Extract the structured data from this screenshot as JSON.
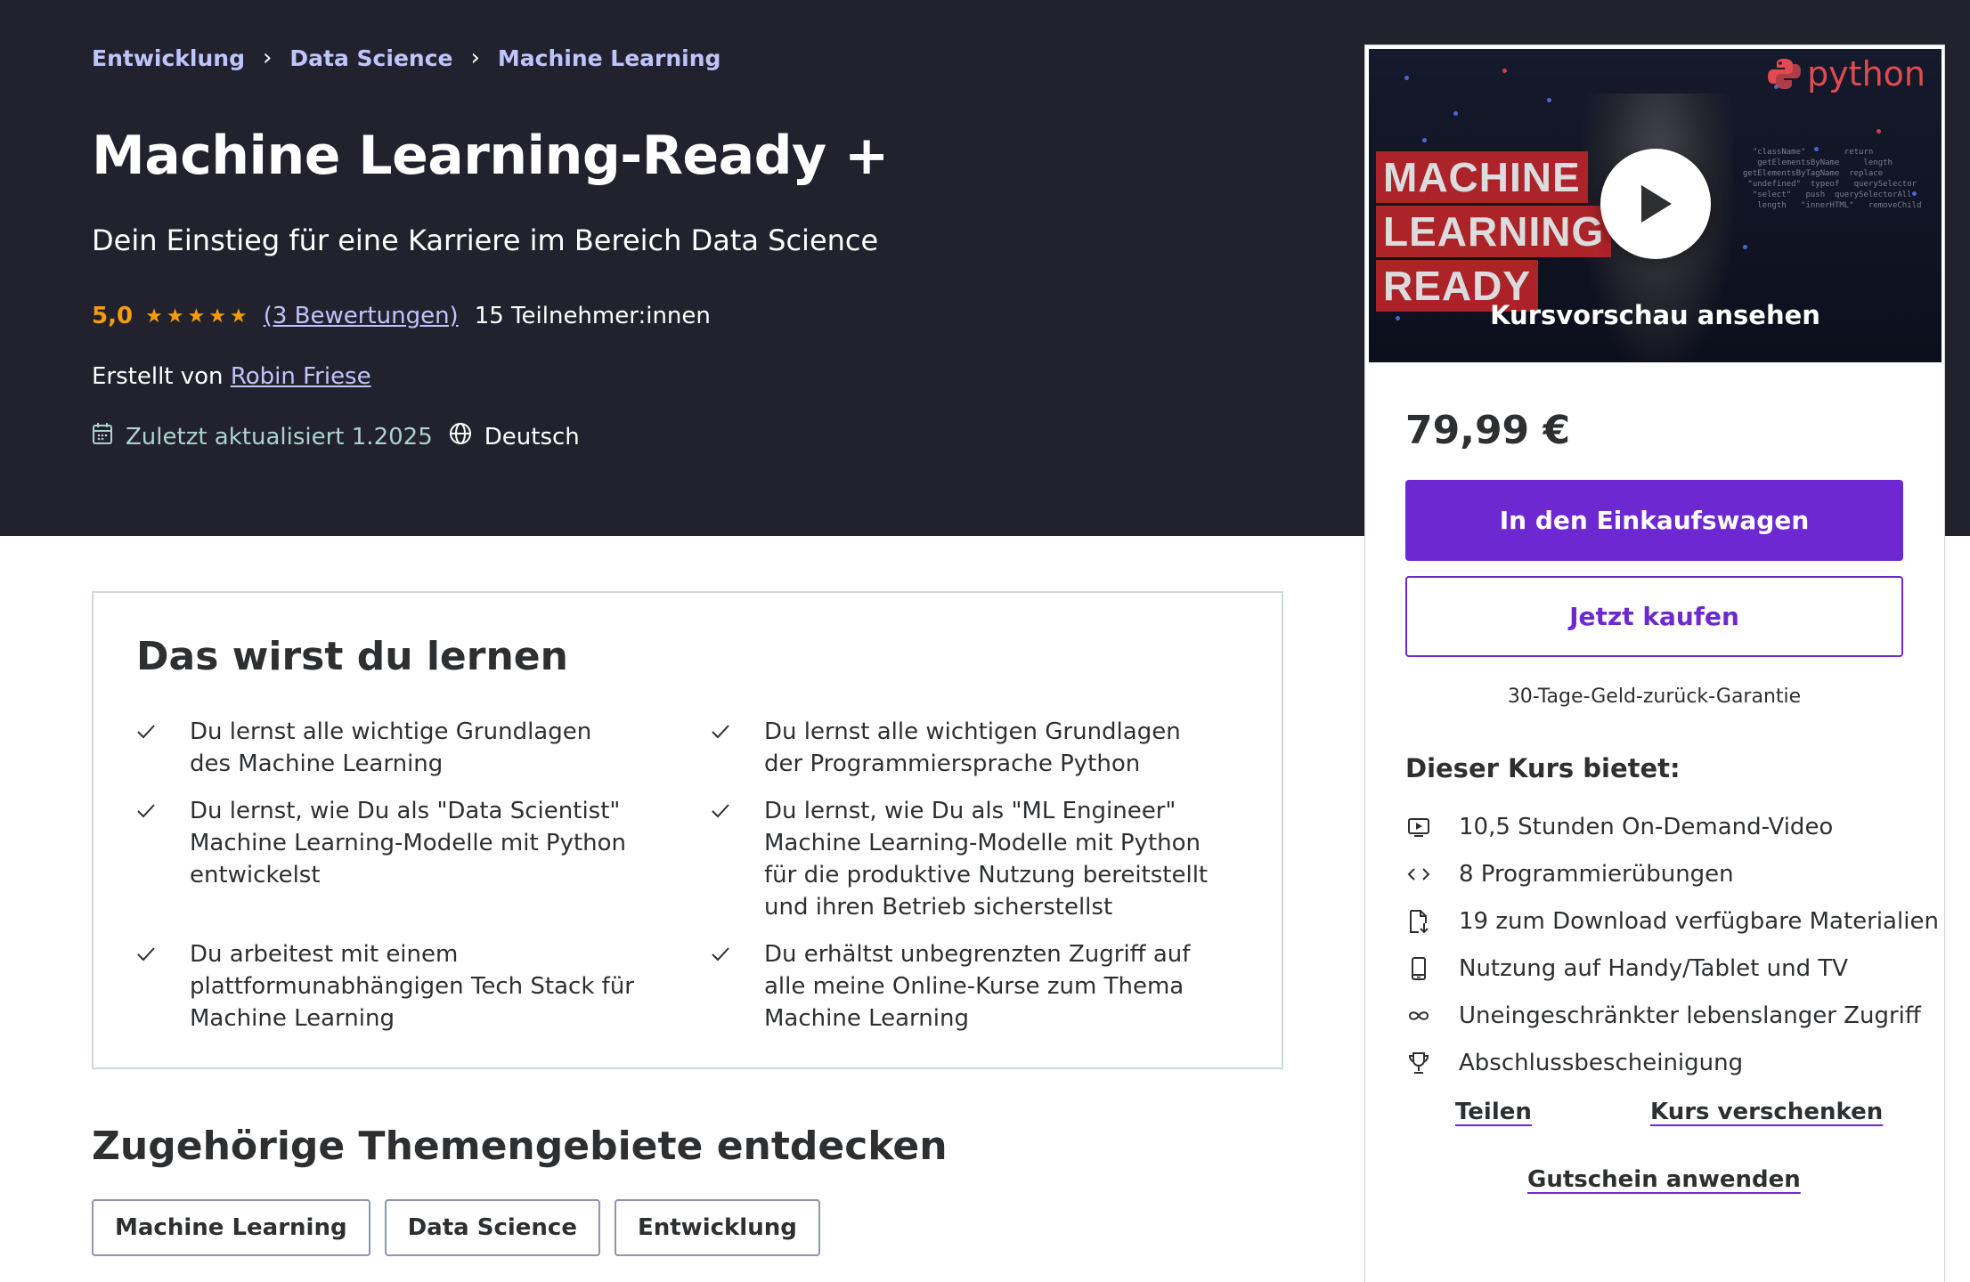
{
  "breadcrumb": [
    "Entwicklung",
    "Data Science",
    "Machine Learning"
  ],
  "course": {
    "title": "Machine Learning-Ready +",
    "subtitle": "Dein Einstieg für eine Karriere im Bereich Data Science",
    "rating": "5,0",
    "rating_value": 5.0,
    "reviews": "(3 Bewertungen)",
    "students": "15 Teilnehmer:innen",
    "author_prefix": "Erstellt von",
    "author": "Robin Friese",
    "updated": "Zuletzt aktualisiert 1.2025",
    "language": "Deutsch"
  },
  "preview": {
    "label": "Kursvorschau ansehen",
    "logo_text": "python",
    "words": [
      "MACHINE",
      "LEARNING",
      "READY"
    ]
  },
  "purchase": {
    "price": "79,99 €",
    "cart_button": "In den Einkaufswagen",
    "buy_button": "Jetzt kaufen",
    "guarantee": "30-Tage-Geld-zurück-Garantie"
  },
  "includes": {
    "title": "Dieser Kurs bietet:",
    "items": [
      {
        "icon": "video-icon",
        "label": "10,5 Stunden On-Demand-Video"
      },
      {
        "icon": "code-icon",
        "label": "8 Programmierübungen"
      },
      {
        "icon": "file-download-icon",
        "label": "19 zum Download verfügbare Materialien"
      },
      {
        "icon": "mobile-icon",
        "label": "Nutzung auf Handy/Tablet und TV"
      },
      {
        "icon": "infinity-icon",
        "label": "Uneingeschränkter lebenslanger Zugriff"
      },
      {
        "icon": "trophy-icon",
        "label": "Abschlussbescheinigung"
      }
    ]
  },
  "links": {
    "share": "Teilen",
    "gift": "Kurs verschenken",
    "coupon": "Gutschein anwenden"
  },
  "learn": {
    "title": "Das wirst du lernen",
    "items": [
      "Du lernst alle wichtige Grundlagen des Machine Learning",
      "Du lernst alle wichtigen Grundlagen der Programmiersprache Python",
      "Du lernst, wie Du als \"Data Scientist\" Machine Learning-Modelle mit Python entwickelst",
      "Du lernst, wie Du als \"ML Engineer\" Machine Learning-Modelle mit Python für die produktive Nutzung bereitstellt und ihren Betrieb sicherstellst",
      "Du arbeitest mit einem plattformunabhängigen Tech Stack für Machine Learning",
      "Du erhältst unbegrenzten Zugriff auf alle meine Online-Kurse zum Thema Machine Learning"
    ]
  },
  "related": {
    "title": "Zugehörige Themengebiete entdecken",
    "tags": [
      "Machine Learning",
      "Data Science",
      "Entwicklung"
    ]
  },
  "colors": {
    "hero_bg": "#22222e",
    "link_purple": "#c0c4fc",
    "star_orange": "#f69c08",
    "updated_green": "#acd2cc",
    "brand_purple": "#6d28d2"
  }
}
